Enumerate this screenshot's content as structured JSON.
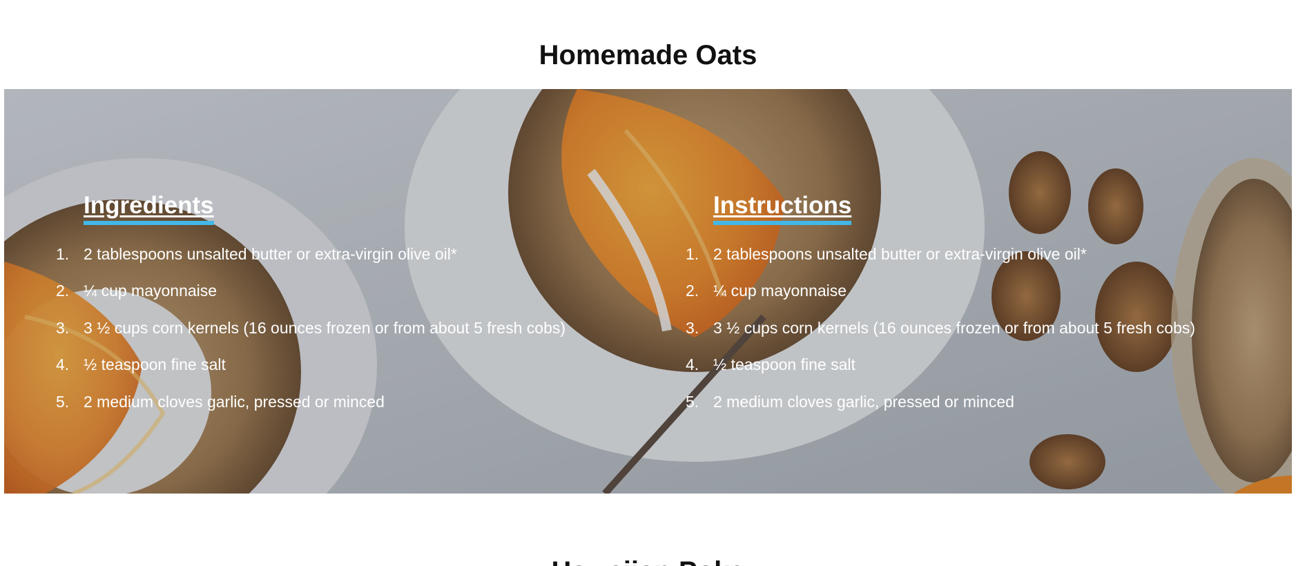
{
  "recipe": {
    "title": "Homemade Oats",
    "ingredients": {
      "heading": "Ingredients",
      "items": [
        {
          "num": "1.",
          "text": "2 tablespoons unsalted butter or extra-virgin olive oil*"
        },
        {
          "num": "2.",
          "text": "¼ cup mayonnaise"
        },
        {
          "num": "3.",
          "text": "3 ½ cups corn kernels (16 ounces frozen or from about 5 fresh cobs)"
        },
        {
          "num": "4.",
          "text": "½ teaspoon fine salt"
        },
        {
          "num": "5.",
          "text": "2 medium cloves garlic, pressed or minced"
        }
      ]
    },
    "instructions": {
      "heading": "Instructions",
      "items": [
        {
          "num": "1.",
          "text": "2 tablespoons unsalted butter or extra-virgin olive oil*"
        },
        {
          "num": "2.",
          "text": "¼ cup mayonnaise"
        },
        {
          "num": "3.",
          "text": "3 ½ cups corn kernels (16 ounces frozen or from about 5 fresh cobs)"
        },
        {
          "num": "4.",
          "text": "½ teaspoon fine salt"
        },
        {
          "num": "5.",
          "text": "2 medium cloves garlic, pressed or minced"
        }
      ]
    }
  },
  "next_recipe": {
    "title": "Hawaiian Poke"
  },
  "colors": {
    "heading_underline": "#42b8e8",
    "title_text": "#111111",
    "overlay_text": "#ffffff"
  }
}
